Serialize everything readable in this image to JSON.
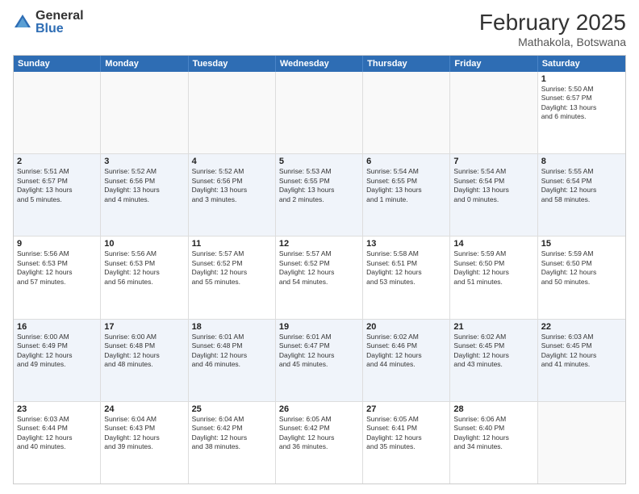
{
  "logo": {
    "general": "General",
    "blue": "Blue"
  },
  "title": "February 2025",
  "location": "Mathakola, Botswana",
  "days": [
    "Sunday",
    "Monday",
    "Tuesday",
    "Wednesday",
    "Thursday",
    "Friday",
    "Saturday"
  ],
  "rows": [
    [
      {
        "day": "",
        "text": ""
      },
      {
        "day": "",
        "text": ""
      },
      {
        "day": "",
        "text": ""
      },
      {
        "day": "",
        "text": ""
      },
      {
        "day": "",
        "text": ""
      },
      {
        "day": "",
        "text": ""
      },
      {
        "day": "1",
        "text": "Sunrise: 5:50 AM\nSunset: 6:57 PM\nDaylight: 13 hours\nand 6 minutes."
      }
    ],
    [
      {
        "day": "2",
        "text": "Sunrise: 5:51 AM\nSunset: 6:57 PM\nDaylight: 13 hours\nand 5 minutes."
      },
      {
        "day": "3",
        "text": "Sunrise: 5:52 AM\nSunset: 6:56 PM\nDaylight: 13 hours\nand 4 minutes."
      },
      {
        "day": "4",
        "text": "Sunrise: 5:52 AM\nSunset: 6:56 PM\nDaylight: 13 hours\nand 3 minutes."
      },
      {
        "day": "5",
        "text": "Sunrise: 5:53 AM\nSunset: 6:55 PM\nDaylight: 13 hours\nand 2 minutes."
      },
      {
        "day": "6",
        "text": "Sunrise: 5:54 AM\nSunset: 6:55 PM\nDaylight: 13 hours\nand 1 minute."
      },
      {
        "day": "7",
        "text": "Sunrise: 5:54 AM\nSunset: 6:54 PM\nDaylight: 13 hours\nand 0 minutes."
      },
      {
        "day": "8",
        "text": "Sunrise: 5:55 AM\nSunset: 6:54 PM\nDaylight: 12 hours\nand 58 minutes."
      }
    ],
    [
      {
        "day": "9",
        "text": "Sunrise: 5:56 AM\nSunset: 6:53 PM\nDaylight: 12 hours\nand 57 minutes."
      },
      {
        "day": "10",
        "text": "Sunrise: 5:56 AM\nSunset: 6:53 PM\nDaylight: 12 hours\nand 56 minutes."
      },
      {
        "day": "11",
        "text": "Sunrise: 5:57 AM\nSunset: 6:52 PM\nDaylight: 12 hours\nand 55 minutes."
      },
      {
        "day": "12",
        "text": "Sunrise: 5:57 AM\nSunset: 6:52 PM\nDaylight: 12 hours\nand 54 minutes."
      },
      {
        "day": "13",
        "text": "Sunrise: 5:58 AM\nSunset: 6:51 PM\nDaylight: 12 hours\nand 53 minutes."
      },
      {
        "day": "14",
        "text": "Sunrise: 5:59 AM\nSunset: 6:50 PM\nDaylight: 12 hours\nand 51 minutes."
      },
      {
        "day": "15",
        "text": "Sunrise: 5:59 AM\nSunset: 6:50 PM\nDaylight: 12 hours\nand 50 minutes."
      }
    ],
    [
      {
        "day": "16",
        "text": "Sunrise: 6:00 AM\nSunset: 6:49 PM\nDaylight: 12 hours\nand 49 minutes."
      },
      {
        "day": "17",
        "text": "Sunrise: 6:00 AM\nSunset: 6:48 PM\nDaylight: 12 hours\nand 48 minutes."
      },
      {
        "day": "18",
        "text": "Sunrise: 6:01 AM\nSunset: 6:48 PM\nDaylight: 12 hours\nand 46 minutes."
      },
      {
        "day": "19",
        "text": "Sunrise: 6:01 AM\nSunset: 6:47 PM\nDaylight: 12 hours\nand 45 minutes."
      },
      {
        "day": "20",
        "text": "Sunrise: 6:02 AM\nSunset: 6:46 PM\nDaylight: 12 hours\nand 44 minutes."
      },
      {
        "day": "21",
        "text": "Sunrise: 6:02 AM\nSunset: 6:45 PM\nDaylight: 12 hours\nand 43 minutes."
      },
      {
        "day": "22",
        "text": "Sunrise: 6:03 AM\nSunset: 6:45 PM\nDaylight: 12 hours\nand 41 minutes."
      }
    ],
    [
      {
        "day": "23",
        "text": "Sunrise: 6:03 AM\nSunset: 6:44 PM\nDaylight: 12 hours\nand 40 minutes."
      },
      {
        "day": "24",
        "text": "Sunrise: 6:04 AM\nSunset: 6:43 PM\nDaylight: 12 hours\nand 39 minutes."
      },
      {
        "day": "25",
        "text": "Sunrise: 6:04 AM\nSunset: 6:42 PM\nDaylight: 12 hours\nand 38 minutes."
      },
      {
        "day": "26",
        "text": "Sunrise: 6:05 AM\nSunset: 6:42 PM\nDaylight: 12 hours\nand 36 minutes."
      },
      {
        "day": "27",
        "text": "Sunrise: 6:05 AM\nSunset: 6:41 PM\nDaylight: 12 hours\nand 35 minutes."
      },
      {
        "day": "28",
        "text": "Sunrise: 6:06 AM\nSunset: 6:40 PM\nDaylight: 12 hours\nand 34 minutes."
      },
      {
        "day": "",
        "text": ""
      }
    ]
  ]
}
